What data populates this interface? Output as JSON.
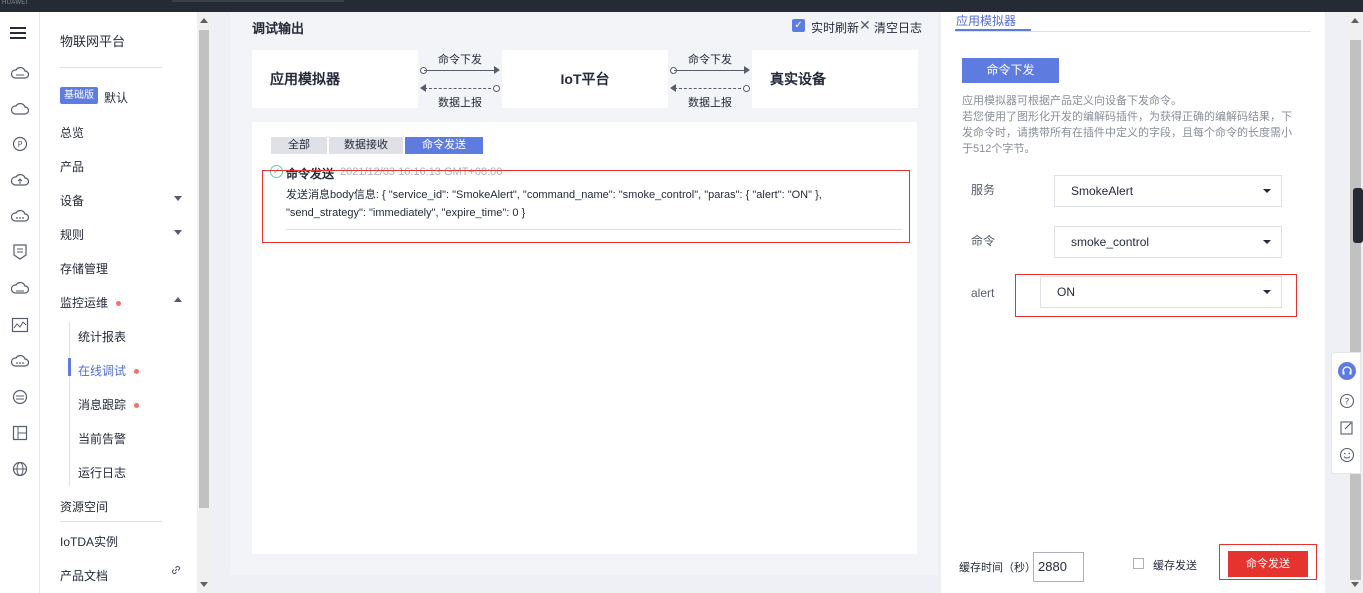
{
  "topbar": {
    "brand": "HUAWEI"
  },
  "sidebar": {
    "title": "物联网平台",
    "edition_badge": "基础版",
    "edition_name": "默认",
    "items": [
      {
        "label": "总览"
      },
      {
        "label": "产品"
      },
      {
        "label": "设备"
      },
      {
        "label": "规则"
      },
      {
        "label": "存储管理"
      },
      {
        "label": "监控运维"
      },
      {
        "label": "资源空间"
      },
      {
        "label": "IoTDA实例"
      },
      {
        "label": "产品文档"
      }
    ],
    "sub_items": [
      {
        "label": "统计报表"
      },
      {
        "label": "在线调试"
      },
      {
        "label": "消息跟踪"
      },
      {
        "label": "当前告警"
      },
      {
        "label": "运行日志"
      }
    ]
  },
  "debug_panel": {
    "title": "调试输出",
    "realtime_refresh_label": "实时刷新",
    "realtime_refresh_checked": true,
    "clear_log_label": "清空日志",
    "flow": {
      "box1": "应用模拟器",
      "box2": "IoT平台",
      "box3": "真实设备",
      "down_label": "命令下发",
      "up_label": "数据上报"
    },
    "tabs": [
      "全部",
      "数据接收",
      "命令发送"
    ],
    "active_tab": "命令发送",
    "log": {
      "title": "命令发送",
      "time": "2021/12/03 16:16:13 GMT+08:00",
      "body": "发送消息body信息: { \"service_id\": \"SmokeAlert\", \"command_name\": \"smoke_control\", \"paras\": { \"alert\": \"ON\" }, \"send_strategy\": \"immediately\", \"expire_time\": 0 }"
    }
  },
  "simulator_panel": {
    "tab_label": "应用模拟器",
    "command_button": "命令下发",
    "description_1": "应用模拟器可根据产品定义向设备下发命令。",
    "description_2": "若您使用了图形化开发的编解码插件，为获得正确的编解码结果，下发命令时，请携带所有在插件中定义的字段，且每个命令的长度需小于512个字节。",
    "fields": {
      "service_label": "服务",
      "service_value": "SmokeAlert",
      "command_label": "命令",
      "command_value": "smoke_control",
      "alert_label": "alert",
      "alert_value": "ON"
    },
    "cache_time_label": "缓存时间（秒）",
    "cache_time_value": "2880",
    "cache_send_label": "缓存发送",
    "cache_send_checked": false,
    "send_button": "命令发送"
  },
  "colors": {
    "primary": "#5e7ce0",
    "danger": "#e5332f",
    "success": "#50d4ab",
    "notify_dot": "#f66f6a"
  }
}
